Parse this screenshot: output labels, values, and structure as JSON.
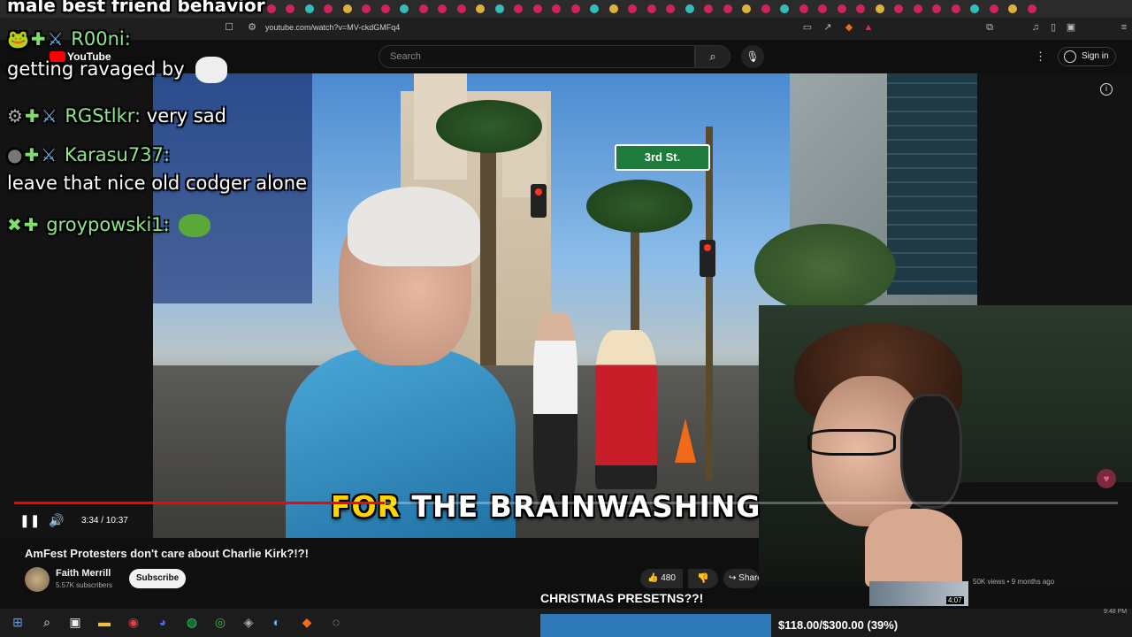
{
  "browser": {
    "url": "youtube.com/watch?v=MV-ckdGMFq4"
  },
  "youtube": {
    "logo": "YouTube",
    "search_placeholder": "Search",
    "sign_in": "Sign in"
  },
  "chat": {
    "title": "male best friend behavior",
    "messages": [
      {
        "user": "R00ni:",
        "text": "getting ravaged by"
      },
      {
        "user": "RGStlkr:",
        "text": "very sad"
      },
      {
        "user": "Karasu737:",
        "text": "leave that nice old codger alone"
      },
      {
        "user": "groypowski1:",
        "text": ""
      }
    ]
  },
  "video": {
    "street_sign": "3rd St.",
    "caption_highlight": "FOR",
    "caption_rest": "THE BRAINWASHING",
    "timecode": "3:34 / 10:37",
    "progress": 0.336,
    "title": "AmFest Protesters don't care about Charlie Kirk?!?!",
    "channel": "Faith Merrill",
    "subscribers": "5.57K subscribers",
    "subscribe_label": "Subscribe",
    "likes": "480",
    "share_label": "Share",
    "suggested_duration": "4:07",
    "suggested_meta": "50K views • 9 months ago"
  },
  "goal": {
    "label": "CHRISTMAS PRESETNS??!",
    "text": "$118.00/$300.00 (39%)",
    "fraction": 0.39
  },
  "taskbar": {
    "time": "9:48 PM"
  },
  "colors": {
    "accent": "#ff0000",
    "chat_name": "#8fe68a",
    "goal_fill": "#2e7ab8",
    "caption_highlight": "#ffd400"
  }
}
